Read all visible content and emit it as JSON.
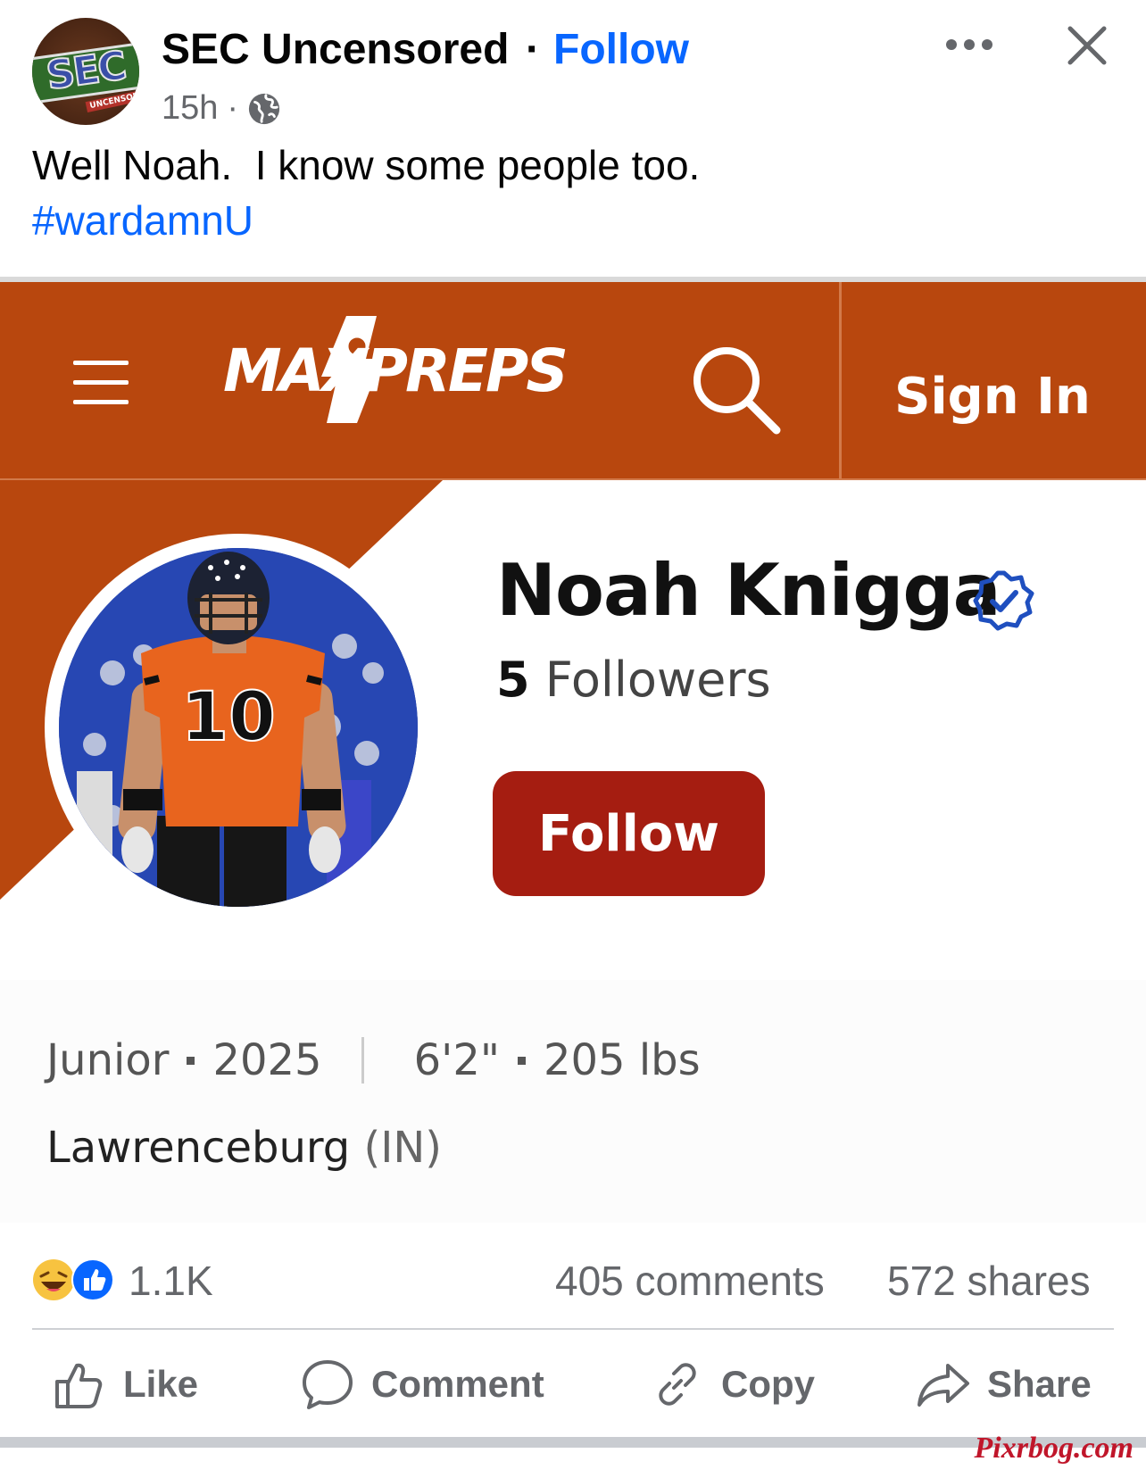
{
  "post": {
    "page_name": "SEC Uncensored",
    "separator": "·",
    "follow_label": "Follow",
    "time": "15h",
    "time_dot": "·",
    "text": "Well Noah.  I know some people too.",
    "hashtag": "#wardamnU",
    "avatar_letters": "SEC",
    "avatar_sub": "UNCENSORED"
  },
  "maxpreps": {
    "logo_text": "MAXPREPS",
    "sign_in": "Sign In",
    "player_name": "Noah Knigga",
    "followers_count": "5",
    "followers_label": "Followers",
    "follow_button": "Follow",
    "class_year_label": "Junior",
    "class_year": "2025",
    "height": "6'2\"",
    "weight": "205 lbs",
    "city": "Lawrenceburg",
    "state": "(IN)",
    "jersey_number": "10",
    "brand_color": "#b8470e",
    "button_color": "#a51d11"
  },
  "stats": {
    "reactions": "1.1K",
    "comments": "405 comments",
    "shares": "572 shares"
  },
  "actions": {
    "like": "Like",
    "comment": "Comment",
    "copy": "Copy",
    "share": "Share"
  },
  "watermark": "Pixrbog.com",
  "icons": [
    "globe-icon",
    "more-icon",
    "close-icon",
    "menu-icon",
    "search-icon",
    "verified-icon",
    "haha-icon",
    "like-reaction-icon",
    "thumbs-up-icon",
    "comment-icon",
    "link-icon",
    "share-icon"
  ],
  "colors": {
    "facebook_blue": "#0866ff",
    "meta_gray": "#65676b"
  }
}
